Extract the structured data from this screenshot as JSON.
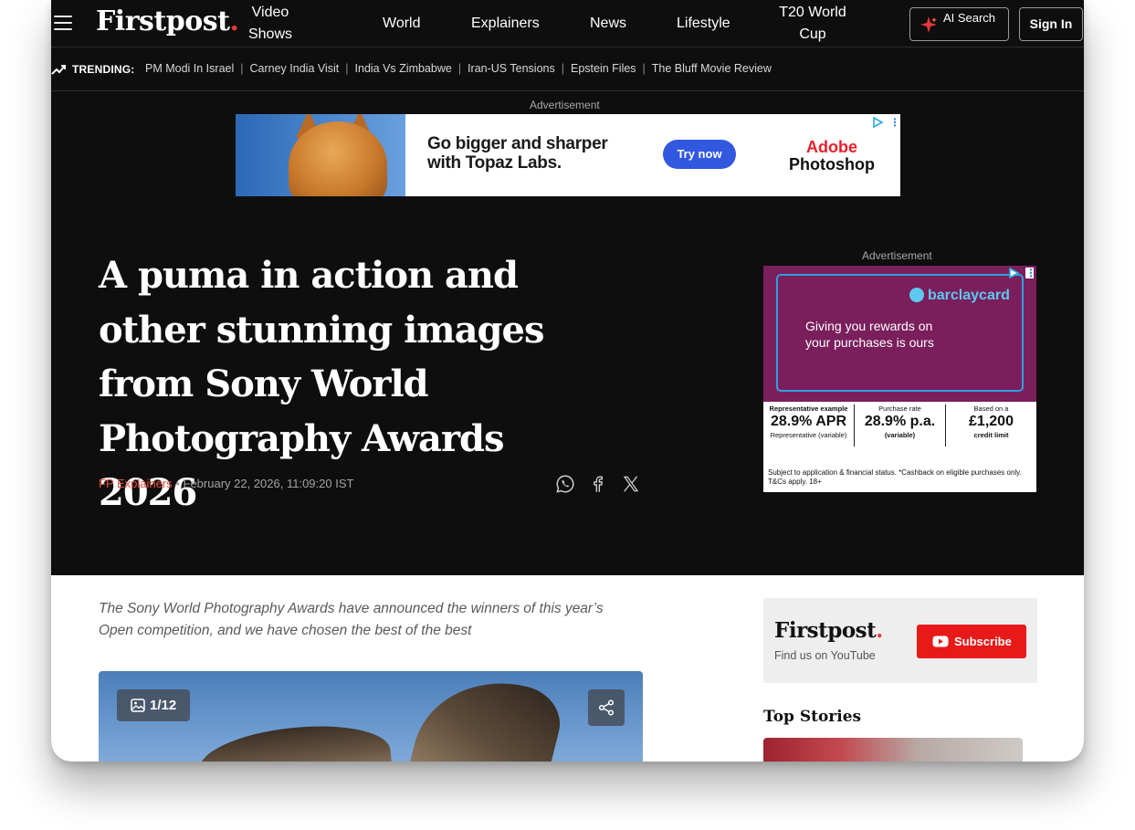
{
  "nav": {
    "logo": "Firstpost",
    "logo_dot": ".",
    "items": [
      {
        "label": "Video Shows"
      },
      {
        "label": "World"
      },
      {
        "label": "Explainers"
      },
      {
        "label": "News"
      },
      {
        "label": "Lifestyle"
      },
      {
        "label": "T20 World Cup"
      }
    ],
    "ai_search_label": "AI Search",
    "sign_in_label": "Sign In"
  },
  "trending": {
    "label": "TRENDING:",
    "items": [
      "PM Modi In Israel",
      "Carney India Visit",
      "India Vs Zimbabwe",
      "Iran-US Tensions",
      "Epstein Files",
      "The Bluff Movie Review"
    ]
  },
  "ads": {
    "label": "Advertisement",
    "topaz": {
      "headline_line1": "Go bigger and sharper",
      "headline_line2": "with Topaz Labs.",
      "cta": "Try now",
      "brand_line1": "Adobe",
      "brand_line2": "Photoshop"
    },
    "barclaycard": {
      "brand": "barclaycard",
      "tagline_line1": "Giving you rewards on",
      "tagline_line2": "your purchases is ours",
      "col1_label": "Representative example",
      "col1_value": "28.9% APR",
      "col1_sub": "Representative (variable)",
      "col2_label": "Purchase rate",
      "col2_value": "28.9% p.a.",
      "col2_sub": "(variable)",
      "col3_label": "Based on a",
      "col3_value": "£1,200",
      "col3_sub": "credit limit",
      "fine_print": "Subject to application & financial status. *Cashback on eligible purchases only. T&Cs apply. 18+"
    }
  },
  "article": {
    "title": "A puma in action and other stunning images from Sony World Photography Awards 2026",
    "author": "FP Explainers",
    "separator": "•",
    "date": "February 22, 2026, 11:09:20 IST",
    "lede": "The Sony World Photography Awards have announced the winners of this year’s Open competition, and we have chosen the best of the best",
    "gallery_count": "1/12"
  },
  "sidebar": {
    "yt_logo": "Firstpost",
    "yt_logo_dot": ".",
    "yt_find": "Find us on YouTube",
    "yt_subscribe": "Subscribe",
    "top_stories": "Top Stories"
  },
  "colors": {
    "background_dark": "#0e0e0e",
    "accent_red": "#e63a2e",
    "author_red": "#e8503f",
    "youtube_red": "#e81919"
  }
}
